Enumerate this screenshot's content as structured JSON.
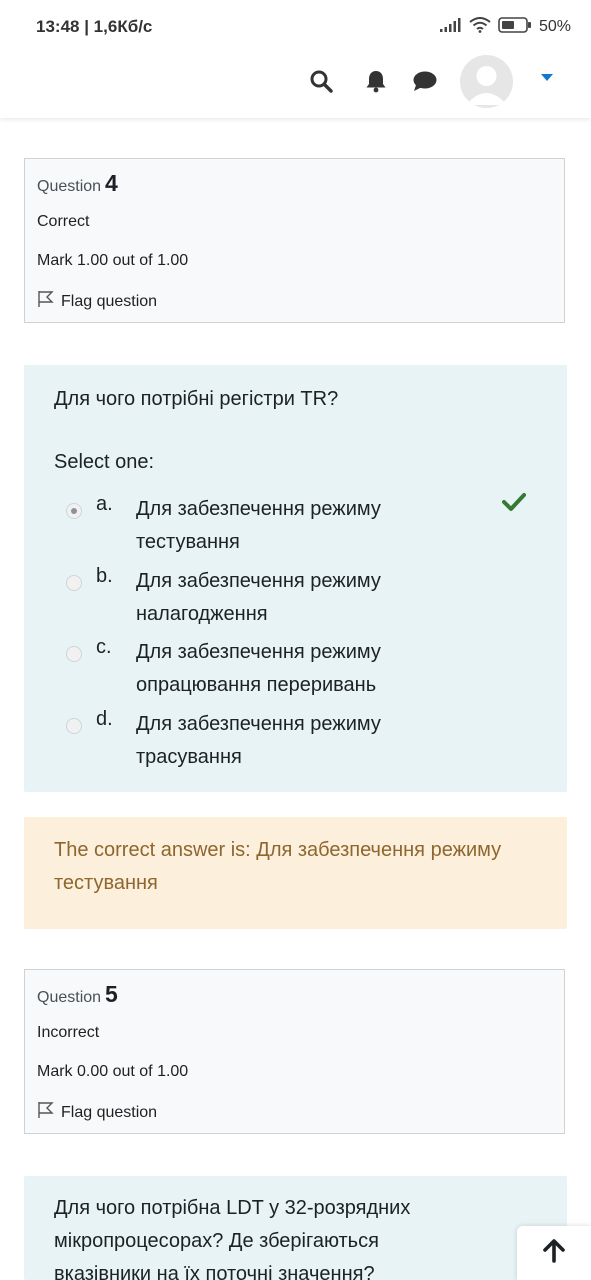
{
  "status_bar": {
    "time_speed": "13:48 | 1,6Кб/с",
    "battery": "50%"
  },
  "navbar": {
    "icons": [
      "search-icon",
      "bell-icon",
      "chat-icon",
      "user-avatar",
      "chevron-down-icon"
    ],
    "accent_color": "#1177d1"
  },
  "questions": [
    {
      "label": "Question",
      "number": "4",
      "state": "Correct",
      "mark": "Mark 1.00 out of 1.00",
      "flag_label": "Flag question",
      "text": "Для чого потрібні регістри TR?",
      "select_label": "Select one:",
      "answers": [
        {
          "letter": "a.",
          "text": "Для забезпечення режиму тестування",
          "selected": true,
          "correct": true
        },
        {
          "letter": "b.",
          "text": "Для забезпечення режиму налагодження",
          "selected": false
        },
        {
          "letter": "c.",
          "text": "Для забезпечення режиму опрацювання переривань",
          "selected": false
        },
        {
          "letter": "d.",
          "text": "Для забезпечення режиму трасування",
          "selected": false
        }
      ],
      "feedback": "The correct answer is: Для забезпечення режиму тестування"
    },
    {
      "label": "Question",
      "number": "5",
      "state": "Incorrect",
      "mark": "Mark 0.00 out of 1.00",
      "flag_label": "Flag question",
      "text": "Для чого потрібна LDT у 32-розрядних мікропроцесорах? Де зберігаються вказівники на їх поточні значення?"
    }
  ],
  "colors": {
    "formulation_bg": "#e7f3f5",
    "feedback_bg": "#fcefdc",
    "feedback_text": "#8e662e",
    "correct_green": "#357a32"
  }
}
